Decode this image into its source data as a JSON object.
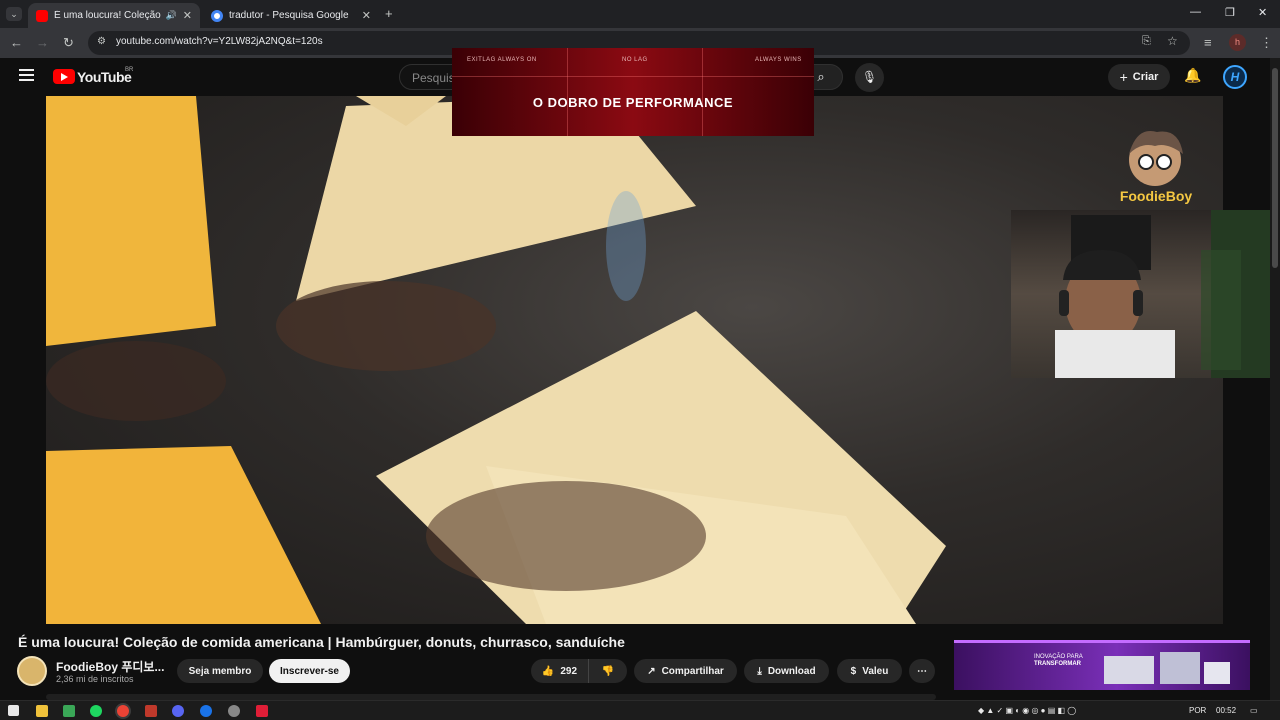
{
  "browser": {
    "tabs": [
      {
        "title": "É uma loucura! Coleção de",
        "favicon_color": "#ff0000"
      },
      {
        "title": "tradutor - Pesquisa Google",
        "favicon_color": "#4285f4"
      }
    ],
    "url": "youtube.com/watch?v=Y2LW82jA2NQ&t=120s",
    "profile_letter": "h"
  },
  "youtube": {
    "logo_text": "YouTube",
    "region": "BR",
    "search_placeholder": "Pesquisar",
    "create_label": "Criar",
    "avatar_letter": "H"
  },
  "ad_overlay": {
    "top_left": "EXITLAG ALWAYS ON",
    "top_center": "NO LAG",
    "top_right": "ALWAYS WINS",
    "headline": "O DOBRO DE PERFORMANCE"
  },
  "video": {
    "watermark": "FoodieBoy",
    "title": "É uma loucura! Coleção de comida americana | Hambúrguer, donuts, churrasco, sanduíche",
    "channel_name": "FoodieBoy 푸디보...",
    "subscribers": "2,36 mi de inscritos",
    "join_label": "Seja membro",
    "subscribe_label": "Inscrever-se",
    "like_count": "292",
    "share_label": "Compartilhar",
    "download_label": "Download",
    "thanks_label": "Valeu"
  },
  "promo": {
    "line1": "INOVAÇÃO PARA",
    "line2": "TRANSFORMAR"
  },
  "taskbar": {
    "language": "POR",
    "time": "00:52"
  },
  "colors": {
    "yt_red": "#ff0000",
    "accent_blue": "#3ea6ff",
    "promo_purple": "#7a2fb8"
  }
}
